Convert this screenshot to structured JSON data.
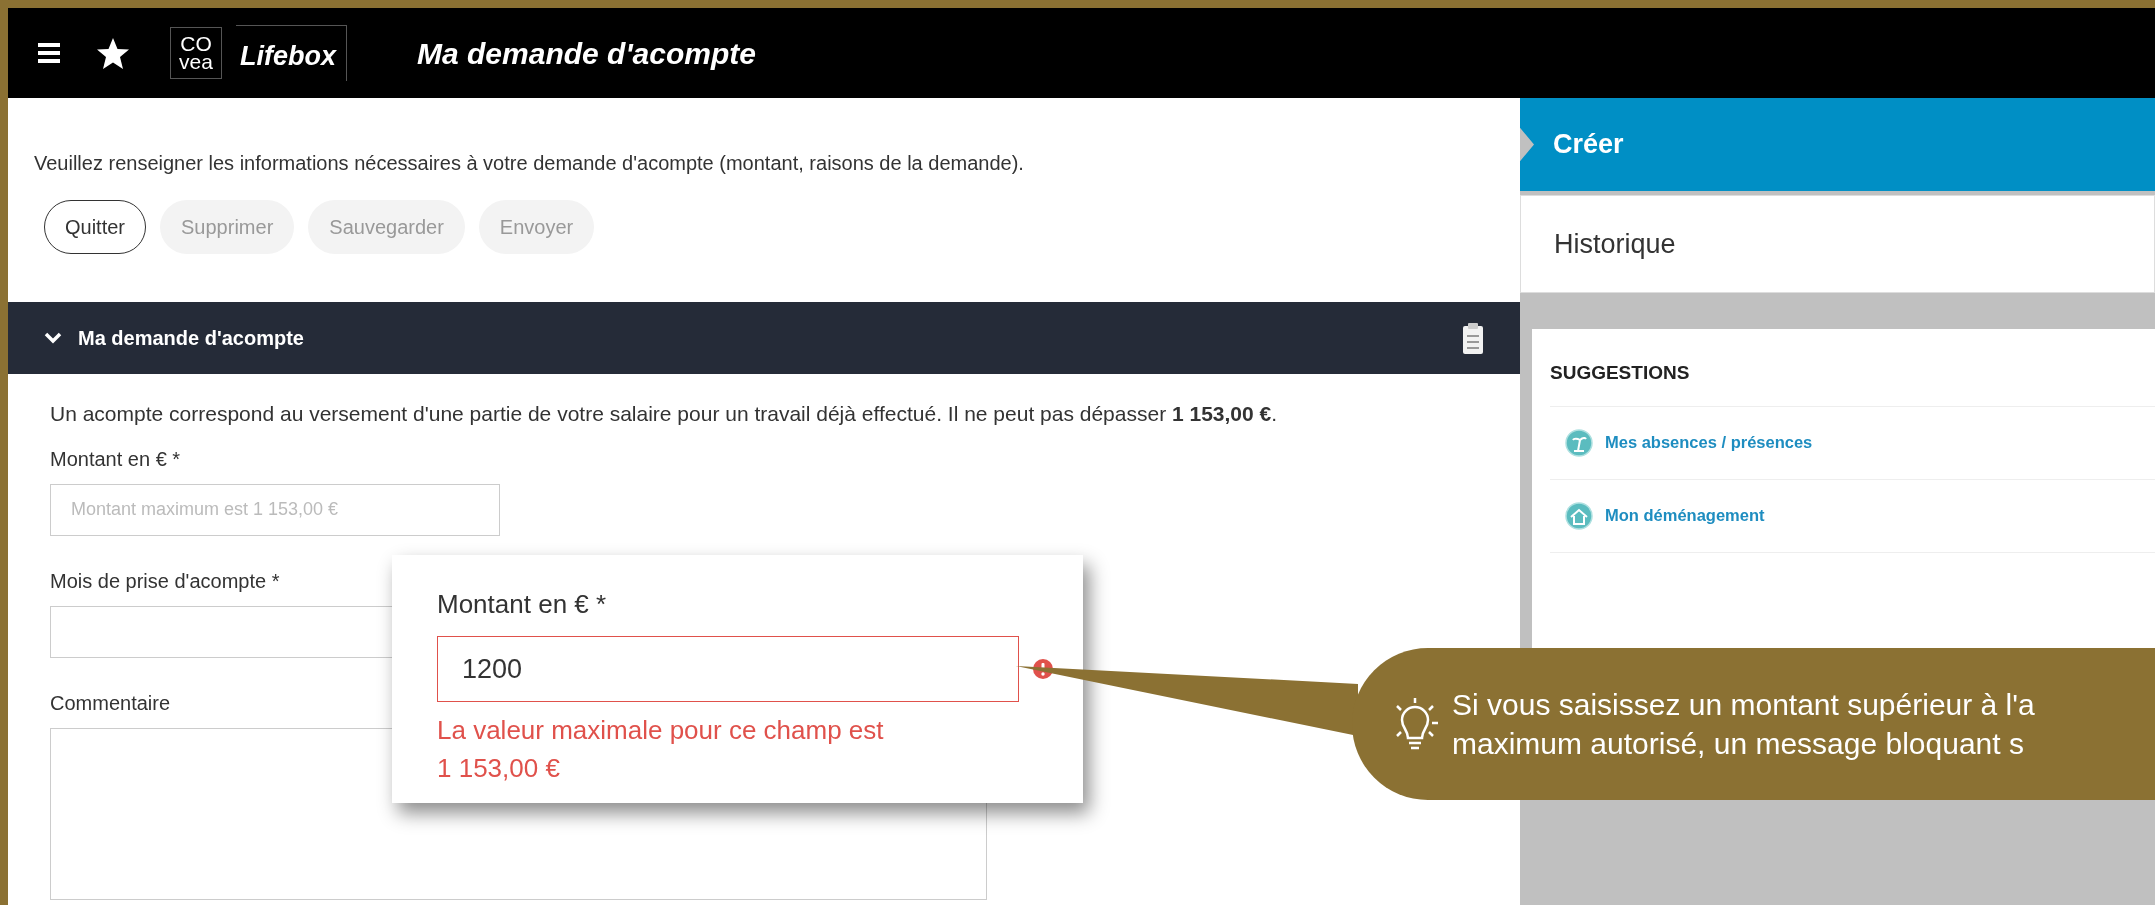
{
  "header": {
    "logo_top": "CO",
    "logo_bottom": "vea",
    "brand": "Lifebox",
    "title": "Ma demande d'acompte"
  },
  "intro": "Veuillez renseigner les informations nécessaires à votre demande d'acompte (montant, raisons de la demande).",
  "buttons": [
    {
      "label": "Quitter",
      "disabled": false
    },
    {
      "label": "Supprimer",
      "disabled": true
    },
    {
      "label": "Sauvegarder",
      "disabled": true
    },
    {
      "label": "Envoyer",
      "disabled": true
    }
  ],
  "section": {
    "title": "Ma demande d'acompte",
    "expanded": true,
    "description": "Un acompte correspond au versement d'une partie de votre salaire pour un travail déjà effectué. Il ne peut pas dépasser **1 153,00 €**.",
    "fields": [
      {
        "kind": "input",
        "label": "Montant en € *",
        "placeholder": "Montant maximum est 1 153,00 €"
      },
      {
        "kind": "input",
        "label": "Mois de prise d'acompte *"
      },
      {
        "kind": "textarea",
        "label": "Commentaire"
      }
    ]
  },
  "zoom_popup": {
    "label": "Montant en € *",
    "value": "1200",
    "invalid": true,
    "error": "La valeur maximale pour ce champ est 1 153,00 €"
  },
  "tip": {
    "lines": [
      "Si vous saisissez un montant supérieur à l'a",
      "maximum autorisé, un message bloquant s"
    ]
  },
  "sidebar": {
    "tabs": [
      {
        "label": "Créer",
        "selected": true
      },
      {
        "label": "Historique",
        "selected": false
      }
    ],
    "suggestions_title": "SUGGESTIONS",
    "suggestions": [
      {
        "label": "Mes absences / présences",
        "kind": "palm"
      },
      {
        "label": "Mon déménagement",
        "kind": "house"
      }
    ]
  }
}
